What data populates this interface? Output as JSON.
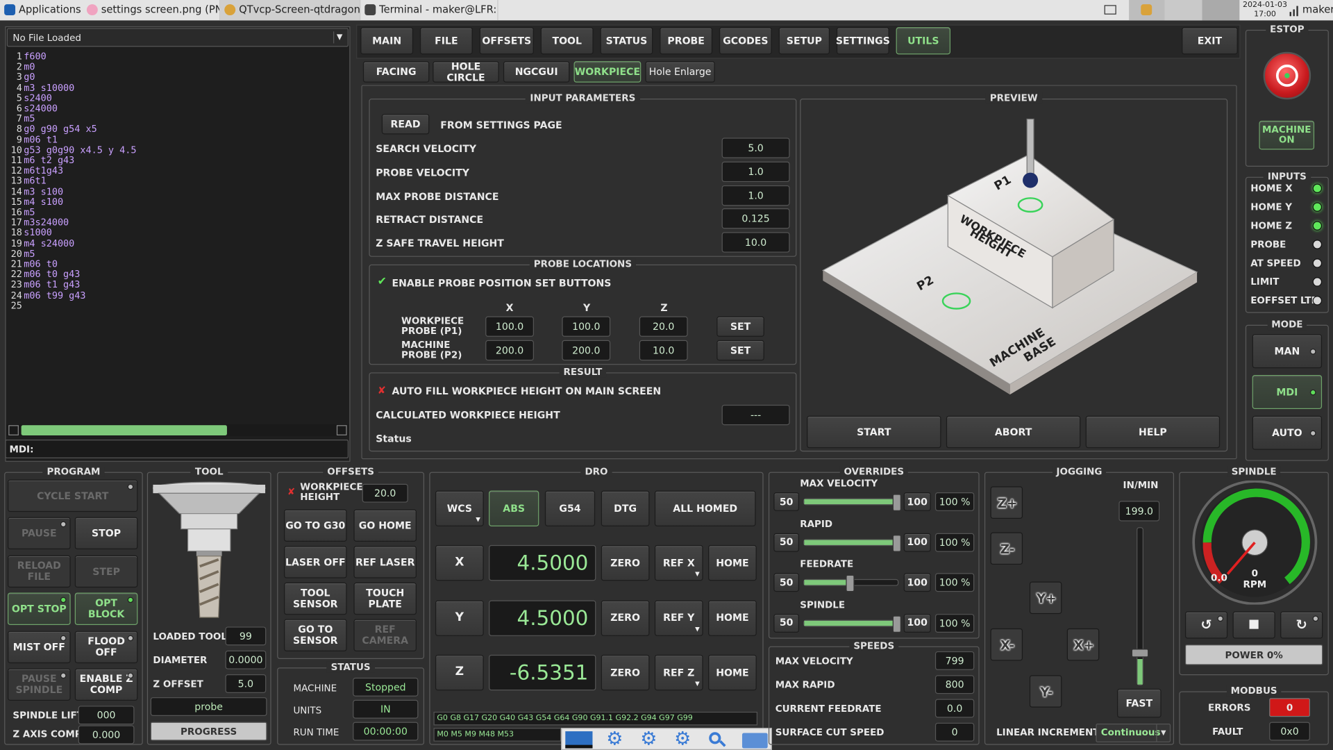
{
  "taskbar": {
    "apps": "Applications",
    "tab1": "settings screen.png (PN...",
    "tab2": "QTvcp-Screen-qtdragon...",
    "tab3": "Terminal - maker@LFR: ...",
    "date": "2024-01-03",
    "time": "17:00",
    "user": "maker"
  },
  "file": {
    "title": "No File Loaded",
    "mdi": "MDI:"
  },
  "gcode": [
    {
      "n": "1",
      "t": "f600"
    },
    {
      "n": "2",
      "t": "m0"
    },
    {
      "n": "3",
      "t": "g0"
    },
    {
      "n": "4",
      "t": "m3 s10000"
    },
    {
      "n": "5",
      "t": "s2400"
    },
    {
      "n": "6",
      "t": "s24000"
    },
    {
      "n": "7",
      "t": "m5"
    },
    {
      "n": "8",
      "t": "g0 g90 g54 x5"
    },
    {
      "n": "9",
      "t": "m06 t1"
    },
    {
      "n": "10",
      "t": "g53 g0g90 x4.5 y 4.5"
    },
    {
      "n": "11",
      "t": "m6 t2 g43"
    },
    {
      "n": "12",
      "t": "m6t1g43"
    },
    {
      "n": "13",
      "t": "m6t1"
    },
    {
      "n": "14",
      "t": "m3 s100"
    },
    {
      "n": "15",
      "t": "m4 s100"
    },
    {
      "n": "16",
      "t": "m5"
    },
    {
      "n": "17",
      "t": "m3s24000"
    },
    {
      "n": "18",
      "t": "s1000"
    },
    {
      "n": "19",
      "t": "m4 s24000"
    },
    {
      "n": "20",
      "t": "m5"
    },
    {
      "n": "21",
      "t": "m06 t0"
    },
    {
      "n": "22",
      "t": "m06 t0 g43"
    },
    {
      "n": "23",
      "t": "m06 t1 g43"
    },
    {
      "n": "24",
      "t": "m06 t99 g43"
    },
    {
      "n": "25",
      "t": ""
    }
  ],
  "maintabs": [
    "MAIN",
    "FILE",
    "OFFSETS",
    "TOOL",
    "STATUS",
    "PROBE",
    "GCODES",
    "SETUP",
    "SETTINGS",
    "UTILS"
  ],
  "exit": "EXIT",
  "subtabs": [
    "FACING",
    "HOLE CIRCLE",
    "NGCGUI",
    "WORKPIECE",
    "Hole Enlarge"
  ],
  "input": {
    "title": "INPUT PARAMETERS",
    "read": "READ",
    "from": "FROM SETTINGS PAGE",
    "rows": [
      {
        "label": "SEARCH VELOCITY",
        "value": "5.0"
      },
      {
        "label": "PROBE VELOCITY",
        "value": "1.0"
      },
      {
        "label": "MAX PROBE DISTANCE",
        "value": "1.0"
      },
      {
        "label": "RETRACT DISTANCE",
        "value": "0.125"
      },
      {
        "label": "Z SAFE TRAVEL HEIGHT",
        "value": "10.0"
      }
    ]
  },
  "probeloc": {
    "title": "PROBE LOCATIONS",
    "enable": "ENABLE PROBE POSITION SET BUTTONS",
    "x": "X",
    "y": "Y",
    "z": "Z",
    "p1": "WORKPIECE PROBE (P1)",
    "p1x": "100.0",
    "p1y": "100.0",
    "p1z": "20.0",
    "p2": "MACHINE PROBE (P2)",
    "p2x": "200.0",
    "p2y": "200.0",
    "p2z": "10.0",
    "set": "SET"
  },
  "result": {
    "title": "RESULT",
    "autofill": "AUTO FILL WORKPIECE HEIGHT ON MAIN SCREEN",
    "calc": "CALCULATED WORKPIECE HEIGHT",
    "calcval": "---",
    "status": "Status"
  },
  "preview": {
    "title": "PREVIEW",
    "p1": "P1",
    "p2": "P2",
    "wp1": "WORKPIECE",
    "wp2": "HEIGHT",
    "mb1": "MACHINE",
    "mb2": "BASE",
    "start": "START",
    "abort": "ABORT",
    "help": "HELP"
  },
  "estop": {
    "title": "ESTOP",
    "machine": "MACHINE ON"
  },
  "inputs": {
    "title": "INPUTS",
    "items": [
      {
        "label": "HOME X",
        "on": true
      },
      {
        "label": "HOME Y",
        "on": true
      },
      {
        "label": "HOME Z",
        "on": true
      },
      {
        "label": "PROBE",
        "on": false
      },
      {
        "label": "AT SPEED",
        "on": false
      },
      {
        "label": "LIMIT",
        "on": false
      },
      {
        "label": "EOFFSET LTD",
        "on": false
      }
    ]
  },
  "mode": {
    "title": "MODE",
    "man": "MAN",
    "mdi": "MDI",
    "auto": "AUTO"
  },
  "program": {
    "title": "PROGRAM",
    "cycle": "CYCLE START",
    "pause": "PAUSE",
    "stop": "STOP",
    "reload": "RELOAD FILE",
    "step": "STEP",
    "optstop": "OPT STOP",
    "optblock": "OPT BLOCK",
    "mist": "MIST OFF",
    "flood": "FLOOD OFF",
    "pausesp": "PAUSE SPINDLE",
    "enablez": "ENABLE Z COMP",
    "lift": "SPINDLE LIFT",
    "liftval": "000",
    "zaxis": "Z AXIS COMP",
    "zaxisval": "0.000"
  },
  "tool": {
    "title": "TOOL",
    "loaded": "LOADED TOOL",
    "loadedval": "99",
    "diameter": "DIAMETER",
    "diameterval": "0.0000",
    "zoffset": "Z OFFSET",
    "zoffsetval": "5.0",
    "probe": "probe",
    "progress": "PROGRESS"
  },
  "offsets": {
    "title": "OFFSETS",
    "wph": "WORKPIECE HEIGHT",
    "wphval": "20.0",
    "g30": "GO TO G30",
    "gohome": "GO HOME",
    "laser": "LASER OFF",
    "reflaser": "REF LASER",
    "toolsensor": "TOOL SENSOR",
    "touch": "TOUCH PLATE",
    "gosensor": "GO TO SENSOR",
    "refcam": "REF CAMERA"
  },
  "status": {
    "title": "STATUS",
    "machine": "MACHINE",
    "machineval": "Stopped",
    "units": "UNITS",
    "unitsval": "IN",
    "runtime": "RUN TIME",
    "runtimeval": "00:00:00"
  },
  "dro": {
    "title": "DRO",
    "wcs": "WCS",
    "abs": "ABS",
    "g54": "G54",
    "dtg": "DTG",
    "homed": "ALL HOMED",
    "zero": "ZERO",
    "home": "HOME",
    "axes": [
      {
        "a": "X",
        "v": "4.5000",
        "ref": "REF X"
      },
      {
        "a": "Y",
        "v": "4.5000",
        "ref": "REF Y"
      },
      {
        "a": "Z",
        "v": "-6.5351",
        "ref": "REF Z"
      }
    ],
    "gcodes": "G0 G8 G17 G20 G40 G43 G54 G64 G90 G91.1 G92.2 G94 G97 G99",
    "mcodes": "M0 M5 M9 M48 M53"
  },
  "overrides": {
    "title": "OVERRIDES",
    "items": [
      {
        "label": "MAX VELOCITY",
        "min": "50",
        "max": "100",
        "pct": "100 %",
        "level": 1.0
      },
      {
        "label": "RAPID",
        "min": "50",
        "max": "100",
        "pct": "100 %",
        "level": 1.0
      },
      {
        "label": "FEEDRATE",
        "min": "50",
        "max": "100",
        "pct": "100 %",
        "level": 0.5
      },
      {
        "label": "SPINDLE",
        "min": "50",
        "max": "100",
        "pct": "100 %",
        "level": 1.0
      }
    ]
  },
  "speeds": {
    "title": "SPEEDS",
    "items": [
      {
        "label": "MAX VELOCITY",
        "value": "799"
      },
      {
        "label": "MAX RAPID",
        "value": "800"
      },
      {
        "label": "CURRENT FEEDRATE",
        "value": "0.0"
      },
      {
        "label": "SURFACE CUT SPEED",
        "value": "0"
      }
    ]
  },
  "jogging": {
    "title": "JOGGING",
    "inmin": "IN/MIN",
    "rate": "199.0",
    "fast": "FAST",
    "zplus": "Z+",
    "zminus": "Z-",
    "yplus": "Y+",
    "yminus": "Y-",
    "xplus": "X+",
    "xminus": "X-",
    "linear": "LINEAR INCREMENT",
    "continuous": "Continuous"
  },
  "spindle": {
    "title": "SPINDLE",
    "gauge": "0.0",
    "rpmval": "0",
    "rpm": "RPM",
    "power": "POWER 0%"
  },
  "modbus": {
    "title": "MODBUS",
    "errors": "ERRORS",
    "errorsval": "0",
    "fault": "FAULT",
    "faultval": "0x0"
  },
  "colors": {
    "accent": "#8fe08a",
    "led_on": "#5fe85a",
    "estop": "#e0282c",
    "error": "#cc1a1a"
  }
}
